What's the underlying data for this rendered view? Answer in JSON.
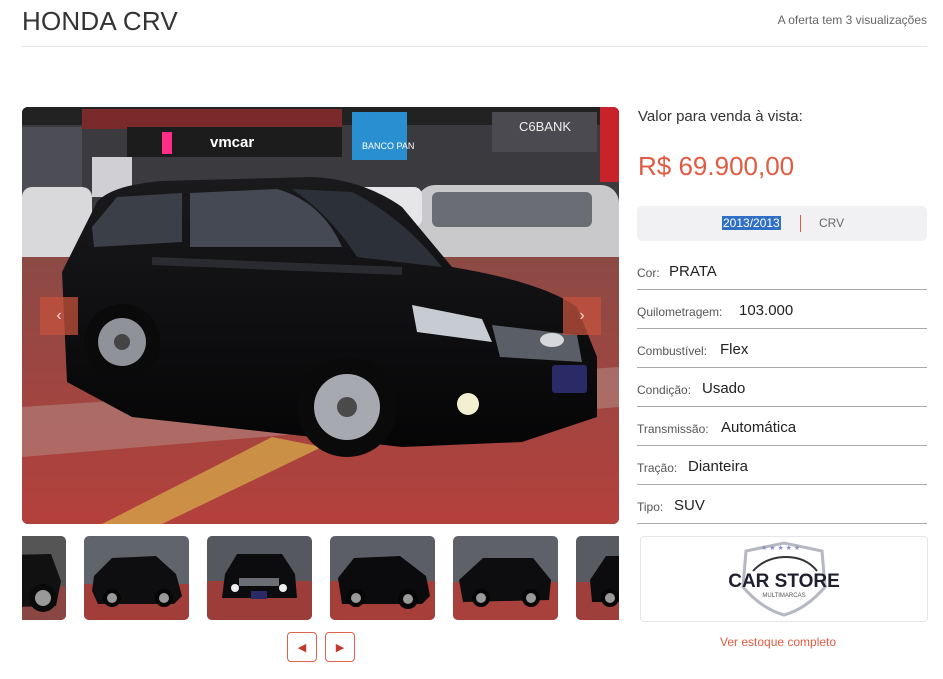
{
  "header": {
    "title": "HONDA CRV",
    "views": "A oferta tem 3 visualizações"
  },
  "gallery": {
    "main_photo": {
      "scene": [
        "vmcar",
        "BANCO PAN",
        "C6BANK"
      ]
    },
    "prev_icon": "chevron-left-icon",
    "next_icon": "chevron-right-icon",
    "thumbnail_count": 6
  },
  "price": {
    "label": "Valor para venda à vista:",
    "value": "R$ 69.900,00",
    "color": "#e15b42"
  },
  "summary": {
    "year": "2013/2013",
    "model": "CRV"
  },
  "specs": [
    {
      "key": "Cor:",
      "value": "PRATA"
    },
    {
      "key": "Quilometragem:",
      "value": "103.000"
    },
    {
      "key": "Combustível:",
      "value": "Flex"
    },
    {
      "key": "Condição:",
      "value": "Usado"
    },
    {
      "key": "Transmissão:",
      "value": "Automática"
    },
    {
      "key": "Tração:",
      "value": "Dianteira"
    },
    {
      "key": "Tipo:",
      "value": "SUV"
    }
  ],
  "dealer": {
    "name": "CAR STORE",
    "tagline": "MULTIMARCAS",
    "stock_link": "Ver estoque completo"
  }
}
